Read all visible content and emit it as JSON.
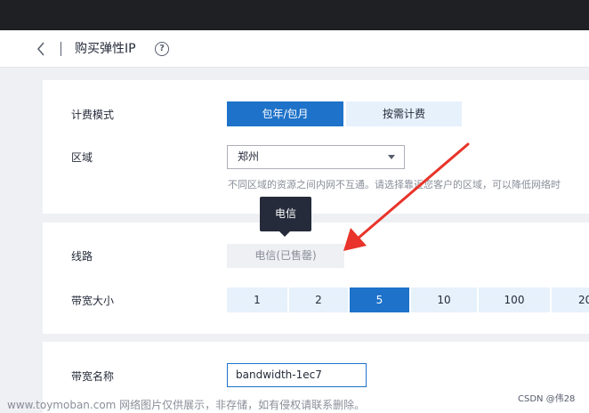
{
  "header": {
    "title": "购买弹性IP",
    "help_glyph": "?"
  },
  "billing": {
    "label": "计费模式",
    "options": [
      "包年/包月",
      "按需计费"
    ],
    "selected": "包年/包月"
  },
  "region": {
    "label": "区域",
    "value": "郑州",
    "hint": "不同区域的资源之间内网不互通。请选择靠近您客户的区域，可以降低网络时"
  },
  "line": {
    "label": "线路",
    "option": "电信(已售罄)",
    "tooltip": "电信"
  },
  "bandwidth": {
    "label": "带宽大小",
    "options": [
      "1",
      "2",
      "5",
      "10",
      "100",
      "20"
    ],
    "selected": "5"
  },
  "bandwidth_name": {
    "label": "带宽名称",
    "value": "bandwidth-1ec7"
  },
  "colors": {
    "accent": "#1e72c9",
    "annotation_arrow": "#e8342a"
  },
  "footer": {
    "watermark": "www.toymoban.com 网络图片仅供展示，非存储，如有侵权请联系删除。",
    "credit": "CSDN @伟28"
  }
}
